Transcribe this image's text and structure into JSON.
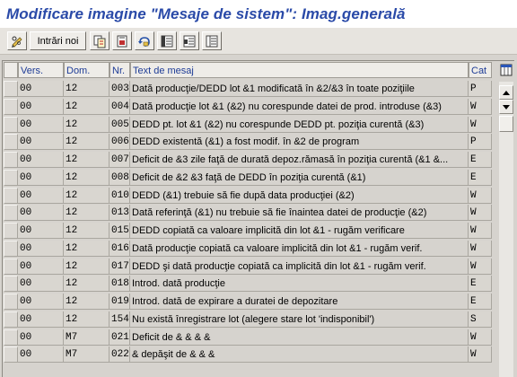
{
  "window": {
    "title": "Modificare imagine \"Mesaje de sistem\": Imag.generală"
  },
  "toolbar": {
    "edit_icon": "pencil-glasses-icon",
    "new_entries_label": "Intrări noi",
    "copy_icon": "copy-as-icon",
    "delete_icon": "delete-icon",
    "undo_icon": "undo-change-icon",
    "select_all_icon": "select-all-icon",
    "select_block_icon": "select-block-icon",
    "deselect_icon": "deselect-all-icon"
  },
  "table": {
    "columns": [
      "Vers.",
      "Dom.",
      "Nr.",
      "Text de mesaj",
      "Cat"
    ],
    "rows": [
      {
        "vers": "00",
        "dom": "12",
        "nr": "003",
        "text": "Dată producţie/DEDD lot &1 modificată în &2/&3 în toate poziţiile",
        "cat": "P"
      },
      {
        "vers": "00",
        "dom": "12",
        "nr": "004",
        "text": "Dată producţie lot &1 (&2) nu corespunde datei de prod. introduse (&3)",
        "cat": "W"
      },
      {
        "vers": "00",
        "dom": "12",
        "nr": "005",
        "text": "DEDD pt. lot &1 (&2) nu corespunde DEDD pt. poziţia curentă (&3)",
        "cat": "W"
      },
      {
        "vers": "00",
        "dom": "12",
        "nr": "006",
        "text": "DEDD existentă (&1) a fost modif. în &2 de program",
        "cat": "P"
      },
      {
        "vers": "00",
        "dom": "12",
        "nr": "007",
        "text": "Deficit de &3 zile faţă de durată depoz.rămasă în poziţia curentă (&1 &...",
        "cat": "E"
      },
      {
        "vers": "00",
        "dom": "12",
        "nr": "008",
        "text": "Deficit de &2 &3 faţă de DEDD în poziţia curentă (&1)",
        "cat": "E"
      },
      {
        "vers": "00",
        "dom": "12",
        "nr": "010",
        "text": "DEDD (&1) trebuie să fie după data producţiei (&2)",
        "cat": "W"
      },
      {
        "vers": "00",
        "dom": "12",
        "nr": "013",
        "text": "Dată referinţă (&1) nu trebuie să fie înaintea datei de producţie (&2)",
        "cat": "W"
      },
      {
        "vers": "00",
        "dom": "12",
        "nr": "015",
        "text": "DEDD copiată ca valoare implicită din lot &1 - rugăm verificare",
        "cat": "W"
      },
      {
        "vers": "00",
        "dom": "12",
        "nr": "016",
        "text": "Dată producţie copiată ca valoare implicită din lot &1 - rugăm verif.",
        "cat": "W"
      },
      {
        "vers": "00",
        "dom": "12",
        "nr": "017",
        "text": "DEDD şi dată producţie copiată ca implicită din lot &1 - rugăm verif.",
        "cat": "W"
      },
      {
        "vers": "00",
        "dom": "12",
        "nr": "018",
        "text": "Introd. dată producţie",
        "cat": "E"
      },
      {
        "vers": "00",
        "dom": "12",
        "nr": "019",
        "text": "Introd. dată de expirare a duratei de depozitare",
        "cat": "E"
      },
      {
        "vers": "00",
        "dom": "12",
        "nr": "154",
        "text": "Nu există înregistrare lot (alegere stare lot 'indisponibil')",
        "cat": "S"
      },
      {
        "vers": "00",
        "dom": "M7",
        "nr": "021",
        "text": "Deficit de & & & &",
        "cat": "W"
      },
      {
        "vers": "00",
        "dom": "M7",
        "nr": "022",
        "text": "& depăşit de & & &",
        "cat": "W"
      }
    ]
  },
  "scrollbar": {
    "up_icon": "scroll-up-icon",
    "down_icon": "scroll-down-icon"
  },
  "colors": {
    "title": "#2a4aa8",
    "header_text": "#1e3c96",
    "background": "#d6d3ce"
  }
}
